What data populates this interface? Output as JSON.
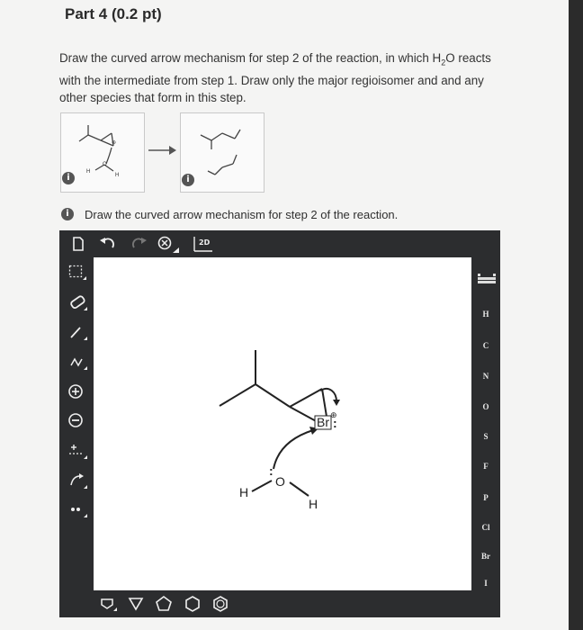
{
  "part_title": "Part 4 (0.2 pt)",
  "instructions": {
    "line1_a": "Draw the curved arrow mechanism for step 2 of the reaction, in which H",
    "line1_sub": "2",
    "line1_b": "O reacts",
    "line2": "with the intermediate from step 1. Draw only the major regioisomer and and any",
    "line3": "other species that form in this step."
  },
  "step_panel": {
    "info_icon_1": "i",
    "info_icon_2": "i",
    "mini_h_left": "H",
    "mini_o": "O",
    "mini_h_right": "H"
  },
  "hint": {
    "icon": "i",
    "text": "Draw the curved arrow mechanism for step 2 of the reaction."
  },
  "editor": {
    "top_tools": [
      "new-document-icon",
      "undo-icon",
      "redo-icon",
      "zoom-clear-icon",
      "2d-view-icon"
    ],
    "view_label": "2D",
    "left_tools": [
      "marquee-select-icon",
      "eraser-icon",
      "bond-icon",
      "chain-icon",
      "positive-charge-icon",
      "negative-charge-icon",
      "charge-increment-icon",
      "curved-arrow-icon",
      "lone-pair-icon"
    ],
    "left_labels": {
      "chain": "zʌ",
      "charge_plus": "+",
      "charge_minus": "−"
    },
    "periodic_table_icon": "periodic-table-icon",
    "elements": [
      "H",
      "C",
      "N",
      "O",
      "S",
      "F",
      "P",
      "Cl",
      "Br",
      "I"
    ],
    "bottom_tools": [
      "template-icon",
      "cyclopropane-icon",
      "cyclopentane-icon",
      "cyclohexane-icon",
      "benzene-icon"
    ],
    "canvas": {
      "atom_br": "Br",
      "lone_pairs": ":",
      "charge_symbol": "⊕",
      "atom_o": "O",
      "atom_h_left": "H",
      "atom_h_right": "H"
    }
  }
}
